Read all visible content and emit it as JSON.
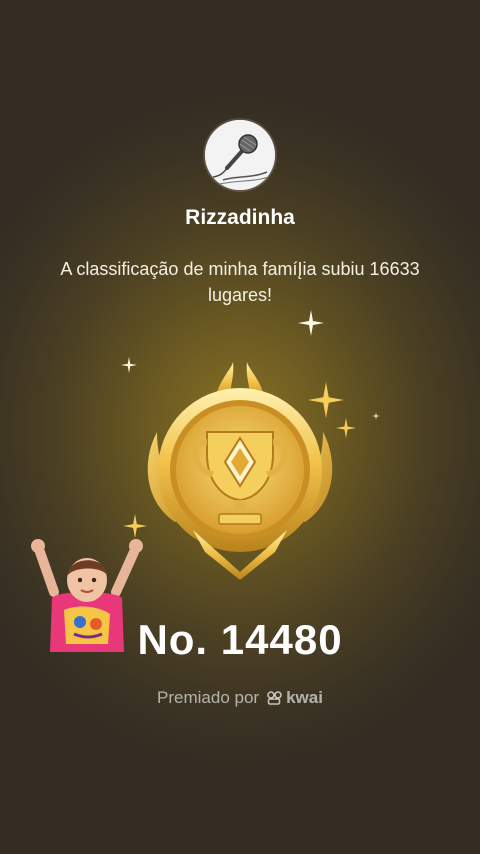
{
  "profile": {
    "avatar_icon": "microphone-icon",
    "username": "Rizzadinha"
  },
  "message": "A classificação de minha famíĮia subiu 16633 lugares!",
  "badge": {
    "icon": "trophy-medal-icon"
  },
  "rank": {
    "text": "No. 14480"
  },
  "awarded": {
    "label": "Premiado por",
    "brand": "kwai",
    "brand_icon": "kwai-logo-icon"
  },
  "sticker": {
    "name": "celebrating-child-sticker"
  },
  "colors": {
    "background": "#4d4123",
    "gold": "#e8b93a",
    "gold_light": "#fde8a0",
    "text": "#ffffff"
  }
}
